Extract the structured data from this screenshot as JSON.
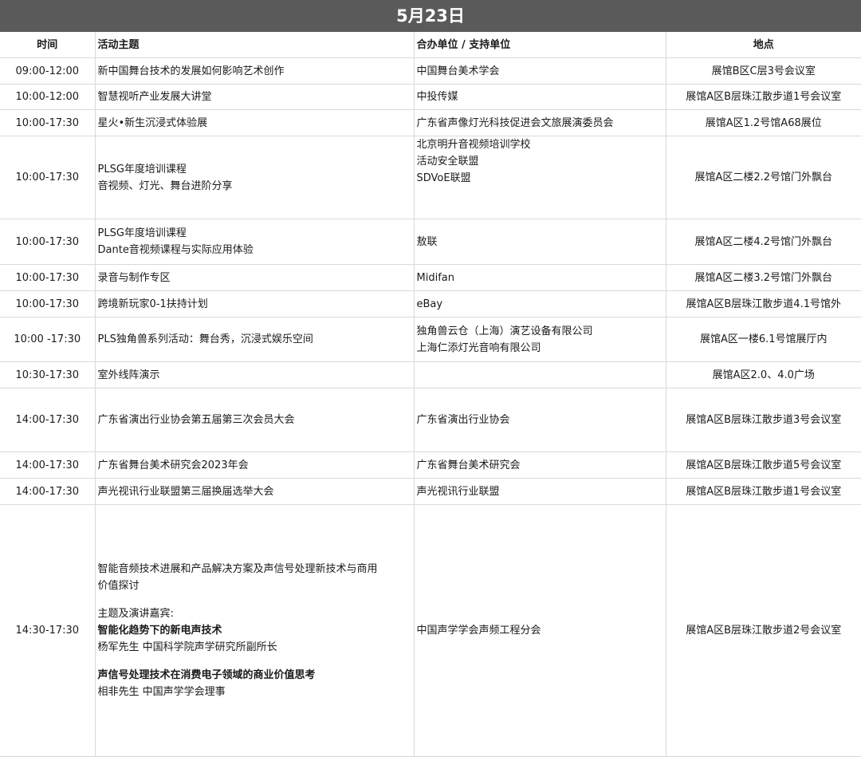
{
  "date_title": "5月23日",
  "headers": {
    "time": "时间",
    "topic": "活动主题",
    "organizer": "合办单位 / 支持单位",
    "venue": "地点"
  },
  "rows": [
    {
      "time": "09:00-12:00",
      "topic": [
        "新中国舞台技术的发展如何影响艺术创作"
      ],
      "org": [
        "中国舞台美术学会"
      ],
      "venue": "展馆B区C层3号会议室"
    },
    {
      "time": "10:00-12:00",
      "topic": [
        "智慧视听产业发展大讲堂"
      ],
      "org": [
        "中投传媒"
      ],
      "venue": "展馆A区B层珠江散步道1号会议室"
    },
    {
      "time": "10:00-17:30",
      "topic": [
        "星火•新生沉浸式体验展"
      ],
      "org": [
        "广东省声像灯光科技促进会文旅展演委员会"
      ],
      "venue": "展馆A区1.2号馆A68展位"
    },
    {
      "time": "10:00-17:30",
      "topic": [
        "PLSG年度培训课程",
        "音视频、灯光、舞台进阶分享"
      ],
      "org": [
        "北京明升音视频培训学校",
        "活动安全联盟",
        "SDVoE联盟"
      ],
      "venue": "展馆A区二楼2.2号馆门外飘台"
    },
    {
      "time": "10:00-17:30",
      "topic": [
        "PLSG年度培训课程",
        "Dante音视频课程与实际应用体验"
      ],
      "org": [
        "敖联"
      ],
      "venue": "展馆A区二楼4.2号馆门外飘台"
    },
    {
      "time": "10:00-17:30",
      "topic": [
        "录音与制作专区"
      ],
      "org": [
        "Midifan"
      ],
      "venue": "展馆A区二楼3.2号馆门外飘台"
    },
    {
      "time": "10:00-17:30",
      "topic": [
        "跨境新玩家0-1扶持计划"
      ],
      "org": [
        "eBay"
      ],
      "venue": "展馆A区B层珠江散步道4.1号馆外"
    },
    {
      "time": "10:00 -17:30",
      "topic": [
        "PLS独角兽系列活动：舞台秀，沉浸式娱乐空间"
      ],
      "org": [
        "独角兽云仓（上海）演艺设备有限公司",
        "上海仁添灯光音响有限公司"
      ],
      "venue": "展馆A区一楼6.1号馆展厅内"
    },
    {
      "time": "10:30-17:30",
      "topic": [
        "室外线阵演示"
      ],
      "org": [],
      "venue": "展馆A区2.0、4.0广场"
    },
    {
      "time": "14:00-17:30",
      "topic": [
        "广东省演出行业协会第五届第三次会员大会"
      ],
      "org": [
        "广东省演出行业协会"
      ],
      "venue": "展馆A区B层珠江散步道3号会议室"
    },
    {
      "time": "14:00-17:30",
      "topic": [
        "广东省舞台美术研究会2023年会"
      ],
      "org": [
        "广东省舞台美术研究会"
      ],
      "venue": "展馆A区B层珠江散步道5号会议室"
    },
    {
      "time": "14:00-17:30",
      "topic": [
        "声光视讯行业联盟第三届换届选举大会"
      ],
      "org": [
        "声光视讯行业联盟"
      ],
      "venue": "展馆A区B层珠江散步道1号会议室"
    }
  ],
  "last_row": {
    "time": "14:30-17:30",
    "topic_l1": "智能音频技术进展和产品解决方案及声信号处理新技术与商用",
    "topic_l2": "价值探讨",
    "speakers_label": "主题及演讲嘉宾:",
    "talk1_title": "智能化趋势下的新电声技术",
    "talk1_speaker": "杨军先生  中国科学院声学研究所副所长",
    "talk2_title": "声信号处理技术在消费电子领域的商业价值思考",
    "talk2_speaker": "相非先生  中国声学学会理事",
    "org": "中国声学学会声频工程分会",
    "venue": "展馆A区B层珠江散步道2号会议室"
  }
}
